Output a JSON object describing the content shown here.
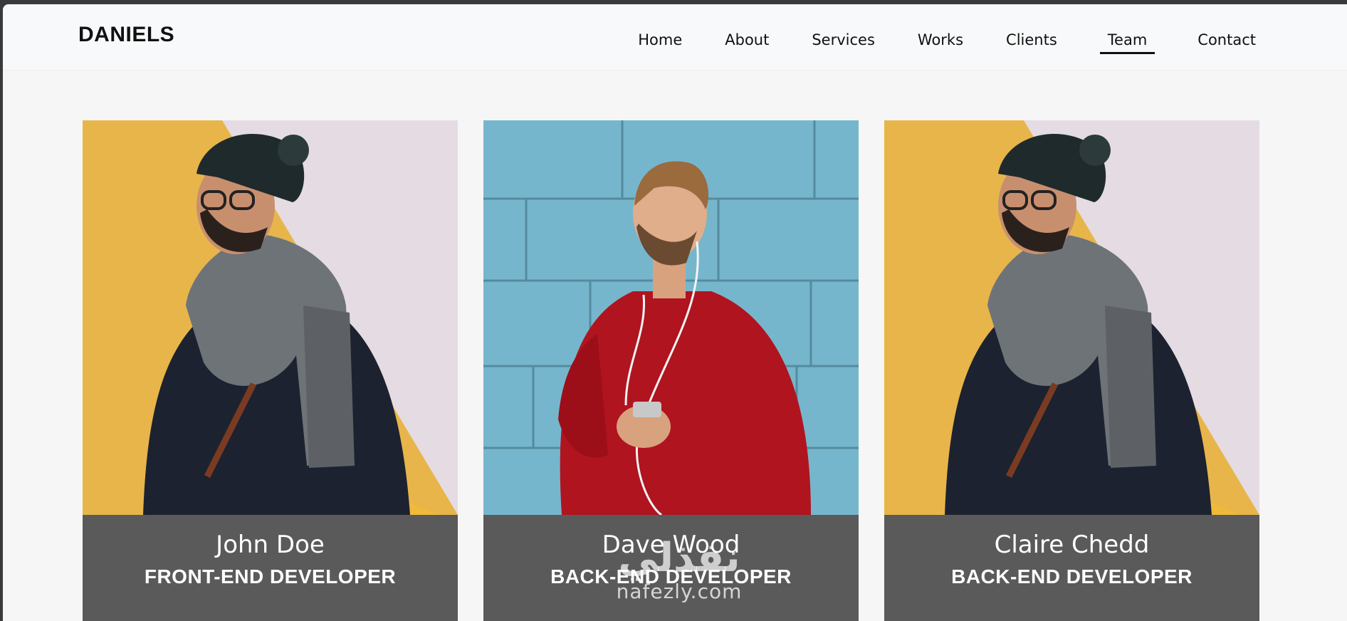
{
  "header": {
    "brand": "DANIELS",
    "nav": [
      {
        "label": "Home",
        "active": false
      },
      {
        "label": "About",
        "active": false
      },
      {
        "label": "Services",
        "active": false
      },
      {
        "label": "Works",
        "active": false
      },
      {
        "label": "Clients",
        "active": false
      },
      {
        "label": "Team",
        "active": true
      },
      {
        "label": "Contact",
        "active": false
      }
    ]
  },
  "team": [
    {
      "name": "John Doe",
      "role": "FRONT-END DEVELOPER",
      "photo": "man-with-beanie-and-scarf-photo"
    },
    {
      "name": "Dave Wood",
      "role": "BACK-END DEVELOPER",
      "photo": "man-in-red-sweater-photo"
    },
    {
      "name": "Claire Chedd",
      "role": "BACK-END DEVELOPER",
      "photo": "man-with-beanie-and-scarf-photo"
    }
  ],
  "watermark": {
    "arabic": "نفذلي",
    "latin": "nafezly.com"
  },
  "colors": {
    "card_caption_bg": "#5a5a5a",
    "page_bg": "#f6f6f6",
    "header_bg": "#f8f9fa"
  }
}
